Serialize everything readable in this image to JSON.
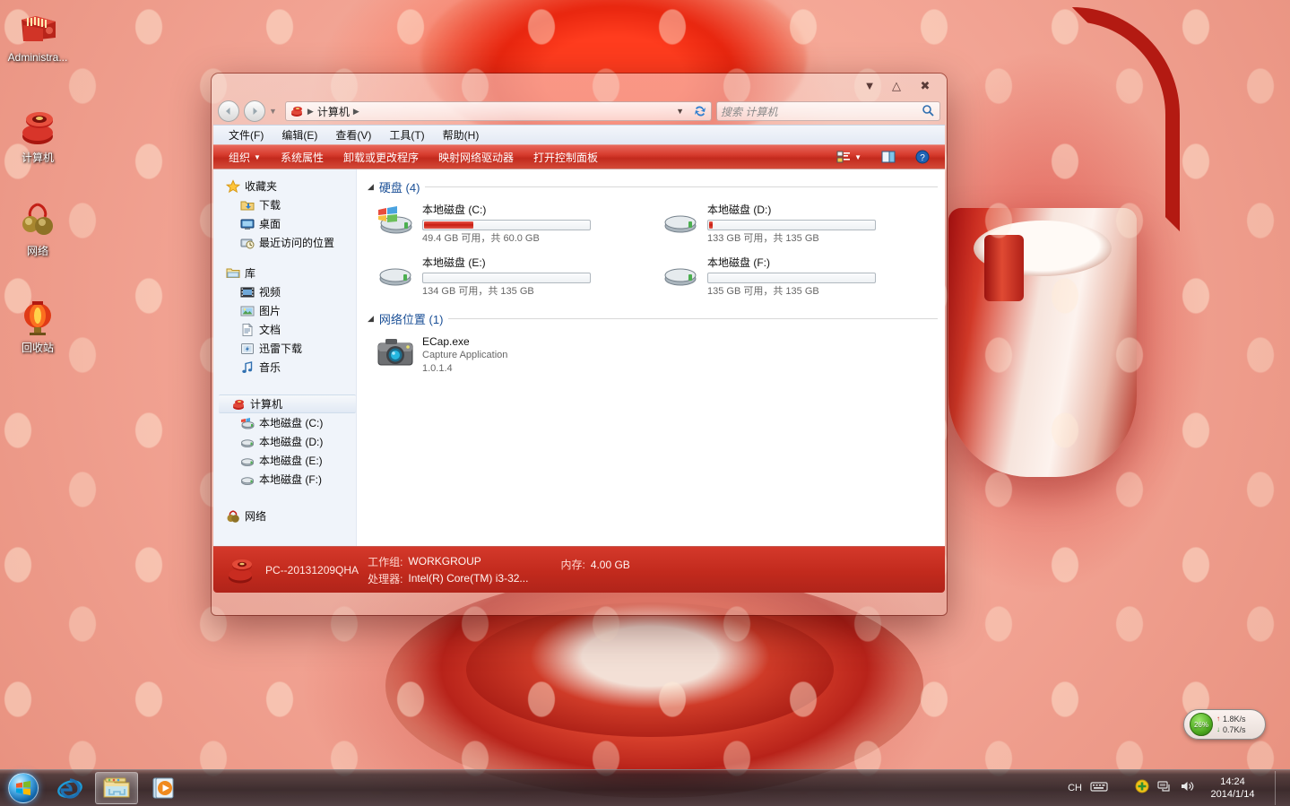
{
  "desktop": {
    "icons": [
      {
        "name": "administrator-folder",
        "label": "Administra...",
        "icon": "red-envelope-folder-icon"
      },
      {
        "name": "computer",
        "label": "计算机",
        "icon": "computer-icon"
      },
      {
        "name": "network",
        "label": "网络",
        "icon": "network-bells-icon"
      },
      {
        "name": "recycle-bin",
        "label": "回收站",
        "icon": "recycle-bin-lantern-icon"
      }
    ]
  },
  "window": {
    "titlebar": {
      "minimize": "▼",
      "maximize": "△",
      "close": "✖"
    },
    "address": {
      "back": "◀",
      "forward": "▶",
      "history_arrow": "▼",
      "computer_icon": "computer-icon",
      "crumb": "计算机",
      "sep": "▶",
      "refresh_icon": "refresh-icon",
      "dropdown": "▼"
    },
    "search": {
      "placeholder": "搜索 计算机",
      "value": "",
      "icon": "search-icon"
    },
    "menubar": [
      {
        "name": "file",
        "label": "文件(F)"
      },
      {
        "name": "edit",
        "label": "编辑(E)"
      },
      {
        "name": "view",
        "label": "查看(V)"
      },
      {
        "name": "tools",
        "label": "工具(T)"
      },
      {
        "name": "help",
        "label": "帮助(H)"
      }
    ],
    "toolbar": {
      "organize": "组织",
      "organize_arrow": "▼",
      "system_properties": "系统属性",
      "uninstall": "卸载或更改程序",
      "map_drive": "映射网络驱动器",
      "control_panel": "打开控制面板",
      "view_icon": "view-options-icon",
      "view_arrow": "▼",
      "preview_icon": "preview-pane-icon",
      "help_icon": "help-icon"
    },
    "nav": [
      {
        "name": "favorites",
        "label": "收藏夹",
        "icon": "star-icon",
        "level": 0
      },
      {
        "name": "downloads",
        "label": "下载",
        "icon": "downloads-icon",
        "level": 1
      },
      {
        "name": "desktop",
        "label": "桌面",
        "icon": "desktop-icon",
        "level": 1
      },
      {
        "name": "recent-places",
        "label": "最近访问的位置",
        "icon": "recent-places-icon",
        "level": 1
      },
      {
        "name": "libraries",
        "label": "库",
        "icon": "library-icon",
        "level": 0,
        "gap_before": true
      },
      {
        "name": "videos",
        "label": "视频",
        "icon": "video-icon",
        "level": 1
      },
      {
        "name": "pictures",
        "label": "图片",
        "icon": "picture-icon",
        "level": 1
      },
      {
        "name": "documents",
        "label": "文档",
        "icon": "document-icon",
        "level": 1
      },
      {
        "name": "thunder-downloads",
        "label": "迅雷下载",
        "icon": "thunder-icon",
        "level": 1
      },
      {
        "name": "music",
        "label": "音乐",
        "icon": "music-icon",
        "level": 1
      },
      {
        "name": "computer",
        "label": "计算机",
        "icon": "computer-icon",
        "level": 0,
        "selected": true,
        "gap_before": true
      },
      {
        "name": "drive-c",
        "label": "本地磁盘 (C:)",
        "icon": "system-drive-icon",
        "level": 1
      },
      {
        "name": "drive-d",
        "label": "本地磁盘 (D:)",
        "icon": "drive-icon",
        "level": 1
      },
      {
        "name": "drive-e",
        "label": "本地磁盘 (E:)",
        "icon": "drive-icon",
        "level": 1
      },
      {
        "name": "drive-f",
        "label": "本地磁盘 (F:)",
        "icon": "drive-icon",
        "level": 1
      },
      {
        "name": "network",
        "label": "网络",
        "icon": "network-icon",
        "level": 0,
        "gap_before": true
      }
    ],
    "groups": [
      {
        "name": "hard-disks",
        "title": "硬盘 (4)",
        "collapse": "◢",
        "items": [
          {
            "name": "drive-c",
            "title": "本地磁盘 (C:)",
            "sub": "49.4 GB 可用，共 60.0 GB",
            "used_pct": 30,
            "icon": "system-drive-icon"
          },
          {
            "name": "drive-d",
            "title": "本地磁盘 (D:)",
            "sub": "133 GB 可用，共 135 GB",
            "used_pct": 2,
            "icon": "drive-icon"
          },
          {
            "name": "drive-e",
            "title": "本地磁盘 (E:)",
            "sub": "134 GB 可用，共 135 GB",
            "used_pct": 0,
            "icon": "drive-icon"
          },
          {
            "name": "drive-f",
            "title": "本地磁盘 (F:)",
            "sub": "135 GB 可用，共 135 GB",
            "used_pct": 0,
            "icon": "drive-icon"
          }
        ]
      },
      {
        "name": "network-locations",
        "title": "网络位置 (1)",
        "collapse": "◢",
        "items": [
          {
            "name": "ecap-exe",
            "title": "ECap.exe",
            "sub": "Capture Application",
            "sub2": "1.0.1.4",
            "icon": "camera-icon"
          }
        ]
      }
    ],
    "status": {
      "icon": "computer-icon",
      "pc_name": "PC--20131209QHA",
      "workgroup_key": "工作组:",
      "workgroup_value": "WORKGROUP",
      "memory_key": "内存:",
      "memory_value": "4.00 GB",
      "cpu_key": "处理器:",
      "cpu_value": "Intel(R) Core(TM) i3-32..."
    }
  },
  "meter": {
    "percent": "26%",
    "up_arrow": "↑",
    "up": "1.8K/s",
    "down_arrow": "↓",
    "down": "0.7K/s"
  },
  "taskbar": {
    "start": "start-orb-icon",
    "buttons": [
      {
        "name": "internet-explorer",
        "icon": "ie-icon",
        "active": false
      },
      {
        "name": "windows-explorer",
        "icon": "explorer-folder-icon",
        "active": true
      },
      {
        "name": "media-player",
        "icon": "media-player-icon",
        "active": false
      }
    ],
    "tray": {
      "ime": "CH",
      "keyboard_icon": "keyboard-icon",
      "shield_icon": "action-center-icon",
      "network_icon": "network-tray-icon",
      "volume_icon": "volume-icon"
    },
    "clock": {
      "time": "14:24",
      "date": "2014/1/14"
    }
  },
  "colors": {
    "accent_red": "#c22a1d",
    "toolbar_red": "#d63a2c",
    "group_title_blue": "#1a4f96",
    "meter_green": "#4ca81e"
  }
}
